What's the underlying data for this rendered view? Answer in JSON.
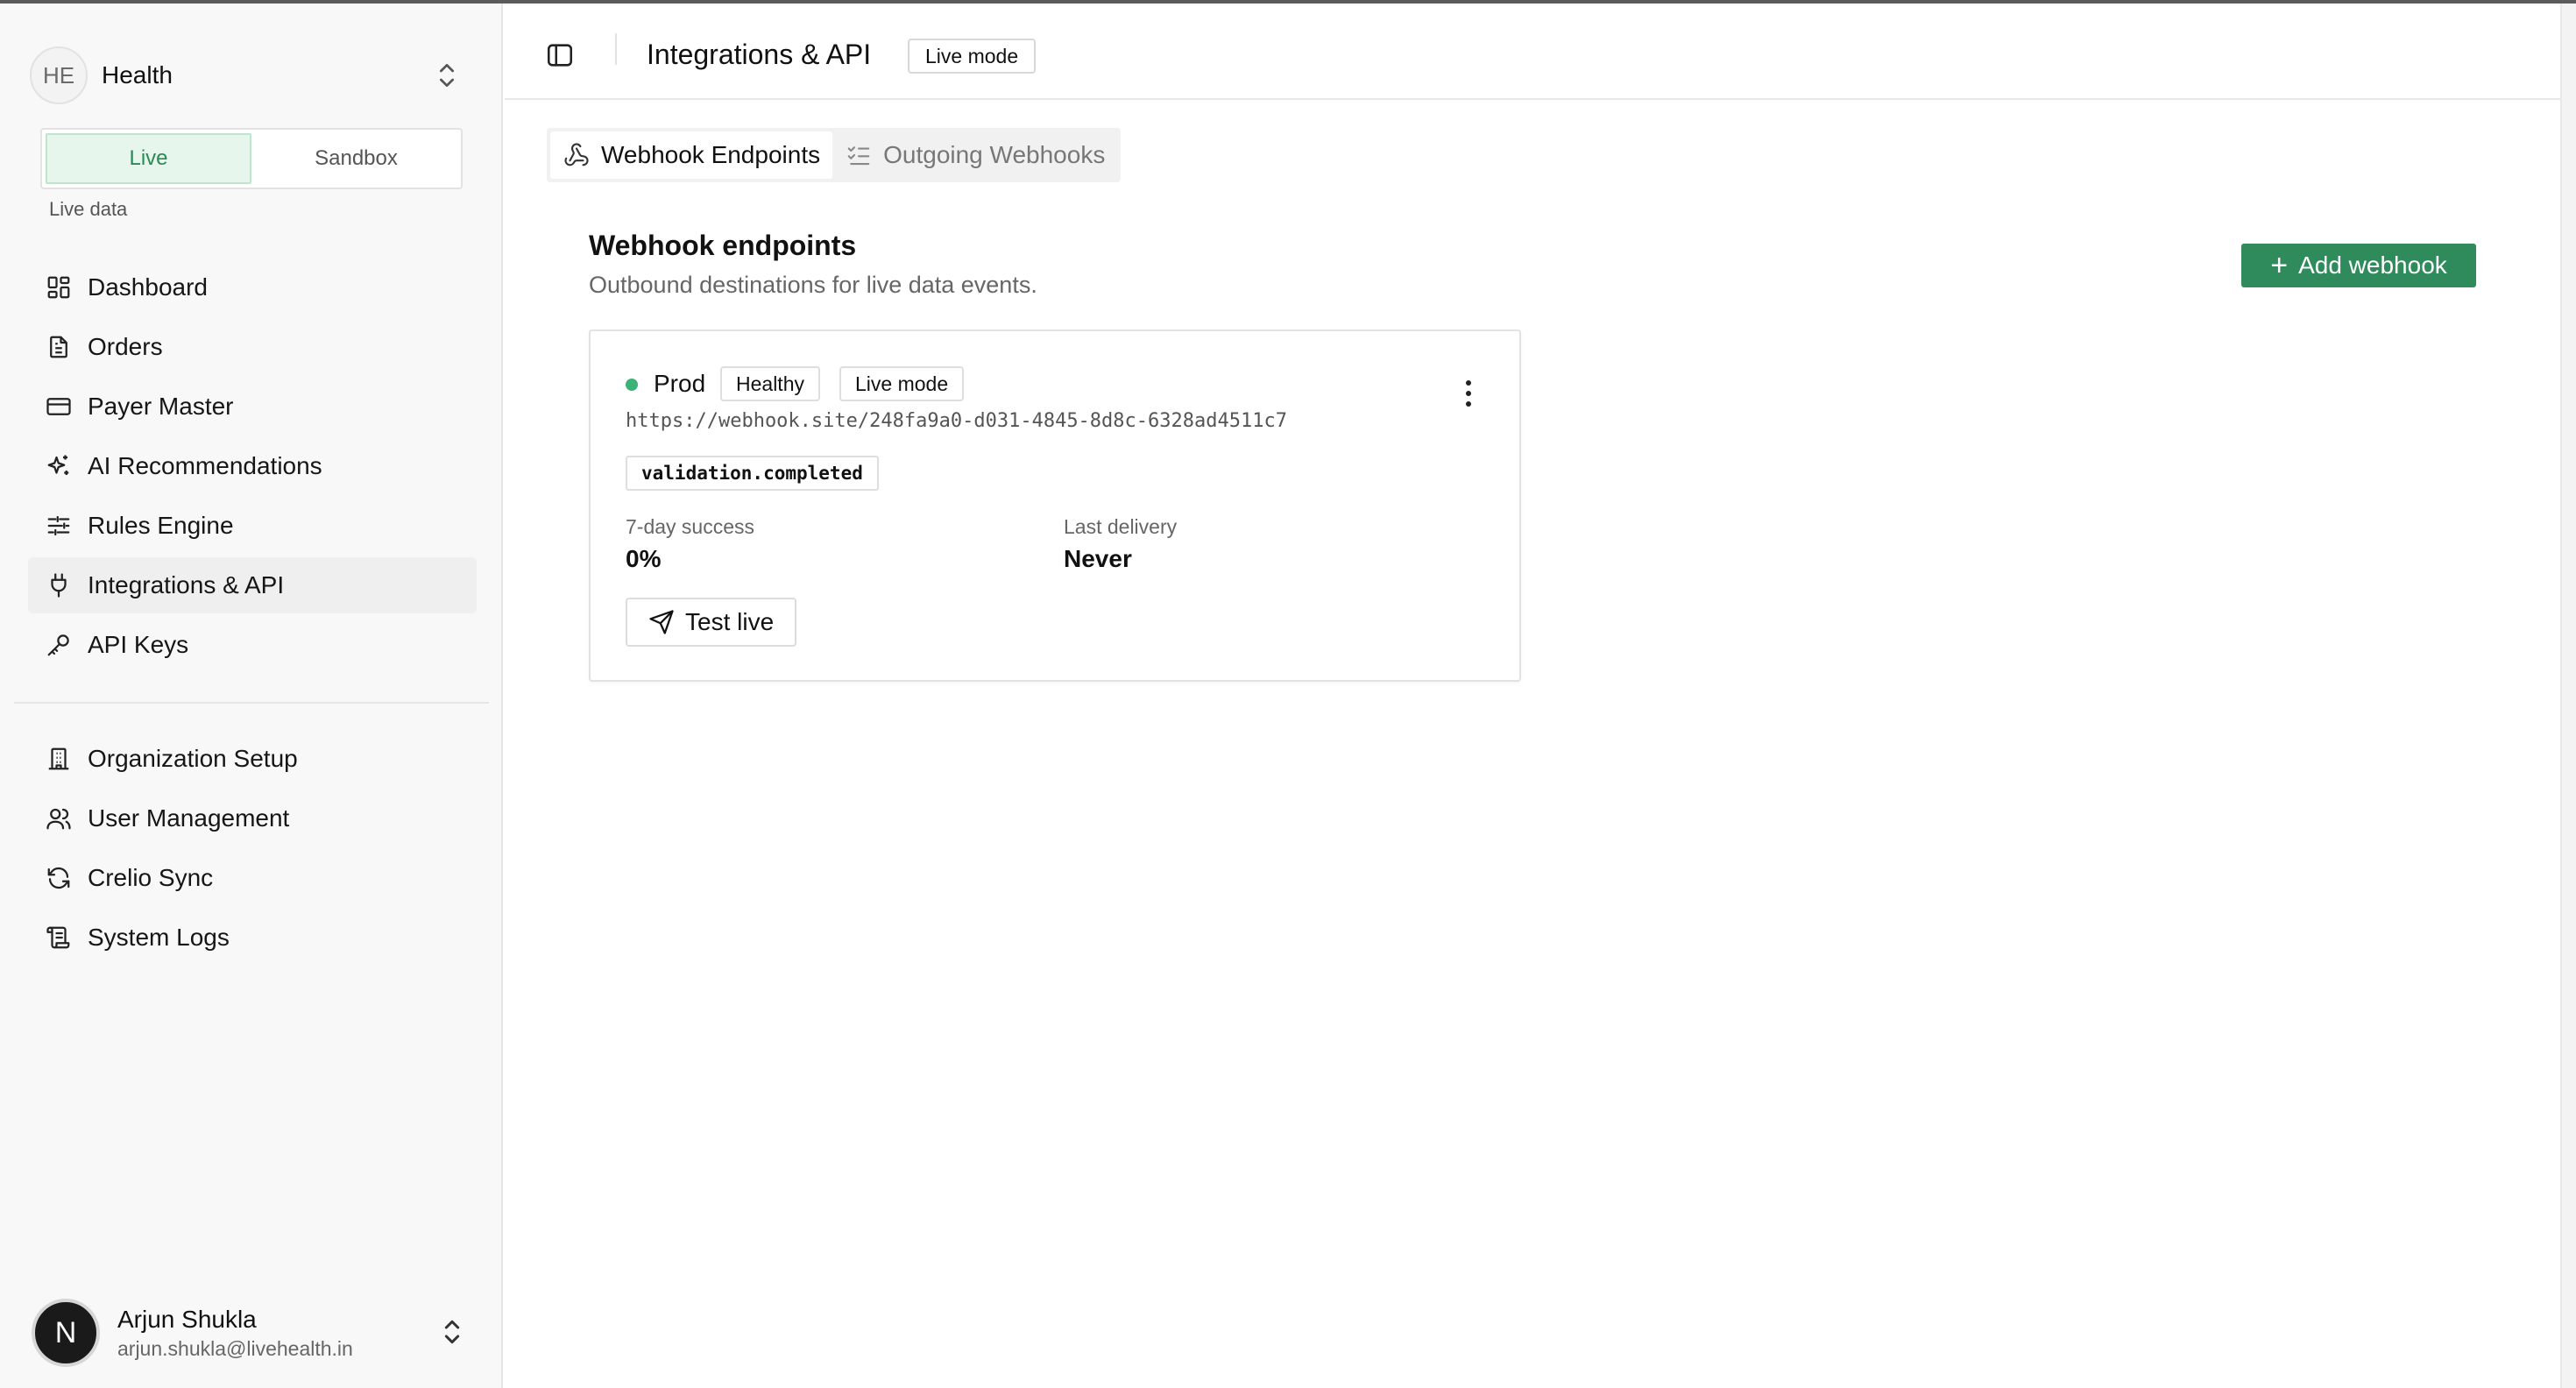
{
  "org": {
    "initials": "HE",
    "name": "Health"
  },
  "mode": {
    "live_label": "Live",
    "sandbox_label": "Sandbox",
    "hint": "Live data",
    "active": "Live"
  },
  "nav": {
    "items": [
      {
        "label": "Dashboard",
        "icon": "dashboard-icon"
      },
      {
        "label": "Orders",
        "icon": "document-icon"
      },
      {
        "label": "Payer Master",
        "icon": "credit-card-icon"
      },
      {
        "label": "AI Recommendations",
        "icon": "sparkles-icon"
      },
      {
        "label": "Rules Engine",
        "icon": "sliders-icon"
      },
      {
        "label": "Integrations & API",
        "icon": "plug-icon",
        "active": true
      },
      {
        "label": "API Keys",
        "icon": "key-icon"
      }
    ],
    "secondary": [
      {
        "label": "Organization Setup",
        "icon": "building-icon"
      },
      {
        "label": "User Management",
        "icon": "users-icon"
      },
      {
        "label": "Crelio Sync",
        "icon": "refresh-icon"
      },
      {
        "label": "System Logs",
        "icon": "scroll-icon"
      }
    ]
  },
  "user": {
    "initial": "N",
    "name": "Arjun Shukla",
    "email": "arjun.shukla@livehealth.in"
  },
  "header": {
    "title": "Integrations & API",
    "badge": "Live mode"
  },
  "tabs": [
    {
      "label": "Webhook Endpoints",
      "icon": "webhook-icon",
      "active": true
    },
    {
      "label": "Outgoing Webhooks",
      "icon": "list-checks-icon",
      "active": false
    }
  ],
  "section": {
    "title": "Webhook endpoints",
    "subtitle": "Outbound destinations for live data events.",
    "add_button": "Add webhook"
  },
  "endpoint": {
    "name": "Prod",
    "health": "Healthy",
    "mode": "Live mode",
    "url": "https://webhook.site/248fa9a0-d031-4845-8d8c-6328ad4511c7",
    "event": "validation.completed",
    "success_label": "7-day success",
    "success_value": "0%",
    "last_delivery_label": "Last delivery",
    "last_delivery_value": "Never",
    "test_button": "Test live",
    "status_color": "#3db276"
  },
  "colors": {
    "accent": "#2f8a5c",
    "live_bg": "#e7f6ec",
    "live_text": "#2a8a54"
  }
}
